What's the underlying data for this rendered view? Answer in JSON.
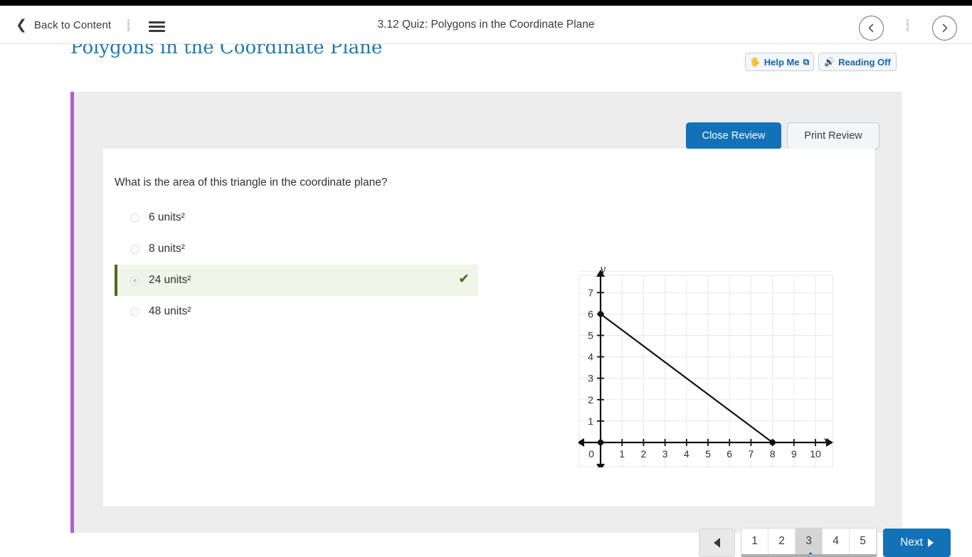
{
  "appbar": {
    "back_label": "Back to Content",
    "title": "3.12 Quiz: Polygons in the Coordinate Plane",
    "back_icon": "chevron-left-icon",
    "menu_icon": "hamburger-menu-icon",
    "prev_icon": "circle-chevron-left-icon",
    "next_icon": "circle-chevron-right-icon"
  },
  "lesson": {
    "title": "Polygons in the Coordinate Plane",
    "title_color": "#1b7aad",
    "accent_bar_color": "#b061cb",
    "help_button": {
      "label": "Help Me",
      "icon": "hand-icon",
      "external_icon": "external-link-icon"
    },
    "reading_button": {
      "label": "Reading  Off",
      "icon": "speaker-icon"
    }
  },
  "review": {
    "close_label": "Close Review",
    "print_label": "Print Review",
    "primary_color": "#1271b7"
  },
  "question": {
    "prompt": "What is the area of this triangle in the coordinate plane?",
    "options": [
      {
        "label": "6 units²",
        "selected": false,
        "correct": false
      },
      {
        "label": "8 units²",
        "selected": false,
        "correct": false
      },
      {
        "label": "24 units²",
        "selected": true,
        "correct": true
      },
      {
        "label": "48 units²",
        "selected": false,
        "correct": false
      }
    ],
    "correct_check_icon": "check-icon",
    "correct_color": "#4d6b1b",
    "correct_row_bg": "#eff6e7"
  },
  "chart_data": {
    "type": "scatter",
    "title": "",
    "xlabel": "x",
    "ylabel": "y",
    "xlim": [
      0,
      10.6
    ],
    "ylim": [
      0,
      7.6
    ],
    "x_ticks": [
      "0",
      "1",
      "2",
      "3",
      "4",
      "5",
      "6",
      "7",
      "8",
      "9",
      "10"
    ],
    "y_ticks": [
      "1",
      "2",
      "3",
      "4",
      "5",
      "6",
      "7"
    ],
    "grid": true,
    "legend": "none",
    "series": [
      {
        "name": "triangle",
        "points": [
          [
            0,
            6
          ],
          [
            8,
            0
          ],
          [
            0,
            0
          ]
        ],
        "marked_vertices": [
          [
            0,
            6
          ],
          [
            8,
            0
          ],
          [
            0,
            0
          ]
        ],
        "closed": true
      }
    ],
    "annotation": "Right triangle with legs 6 units (vertical) and 8 units (horizontal); area 24 units²"
  },
  "pager": {
    "prev_icon": "triangle-left-icon",
    "pages": [
      "1",
      "2",
      "3",
      "4",
      "5"
    ],
    "active_page": "3",
    "next_label": "Next",
    "next_icon": "triangle-right-icon"
  }
}
